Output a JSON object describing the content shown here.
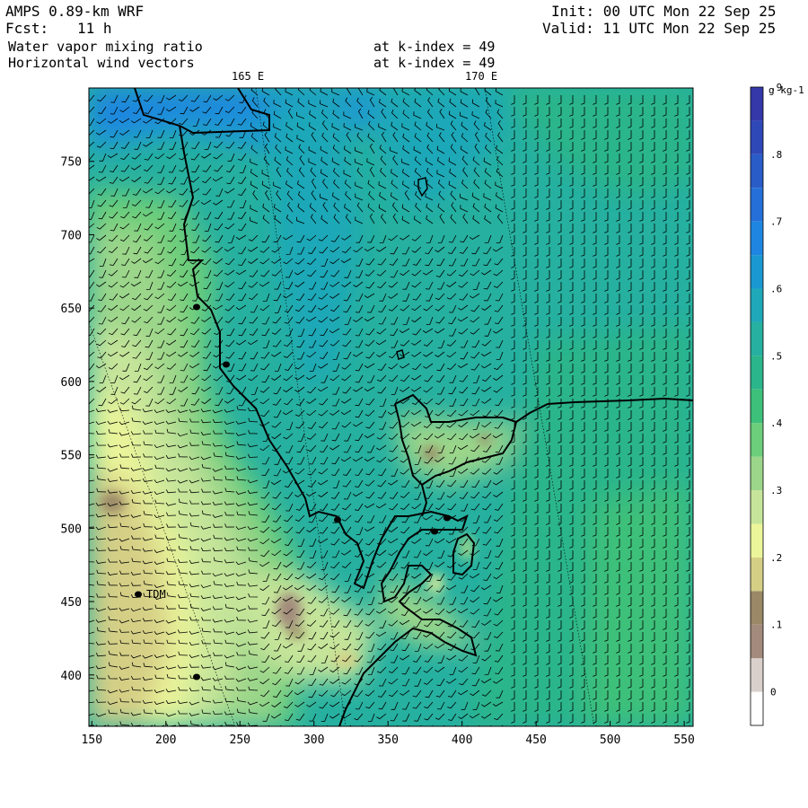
{
  "header": {
    "model": "AMPS 0.89-km WRF",
    "fcst_label": "Fcst:",
    "fcst_value": "11 h",
    "init": "Init: 00 UTC Mon 22 Sep 25",
    "valid": "Valid: 11 UTC Mon 22 Sep 25"
  },
  "fields": [
    {
      "name": "Water vapor mixing ratio",
      "level": "at k-index = 49"
    },
    {
      "name": "Horizontal wind vectors",
      "level": "at k-index = 49"
    }
  ],
  "longitude_labels": [
    "165 E",
    "170 E"
  ],
  "station": {
    "label": "TDM"
  },
  "x_axis": {
    "ticks": [
      "150",
      "200",
      "250",
      "300",
      "350",
      "400",
      "450",
      "500",
      "550"
    ],
    "range": [
      148,
      556
    ]
  },
  "y_axis": {
    "ticks": [
      "750",
      "700",
      "650",
      "600",
      "550",
      "500",
      "450",
      "400"
    ],
    "range": [
      365,
      800
    ]
  },
  "colorbar": {
    "unit": "g kg-1",
    "labels": [
      "0",
      ".1",
      ".2",
      ".3",
      ".4",
      ".5",
      ".6",
      ".7",
      ".8",
      ".9"
    ],
    "colors": [
      "#ffffff",
      "#d9d0cb",
      "#a28a7c",
      "#9a8866",
      "#d5cf86",
      "#ebf59a",
      "#c6e59a",
      "#9bd68a",
      "#6ccd7a",
      "#3dc07a",
      "#2bb58a",
      "#26b0a0",
      "#1fa8b8",
      "#1a98d2",
      "#1e86e0",
      "#2470d8",
      "#2a5cc8",
      "#2f48b8",
      "#3438a8"
    ]
  },
  "legend": {
    "colormap": "water-vapor-mixing-ratio"
  }
}
